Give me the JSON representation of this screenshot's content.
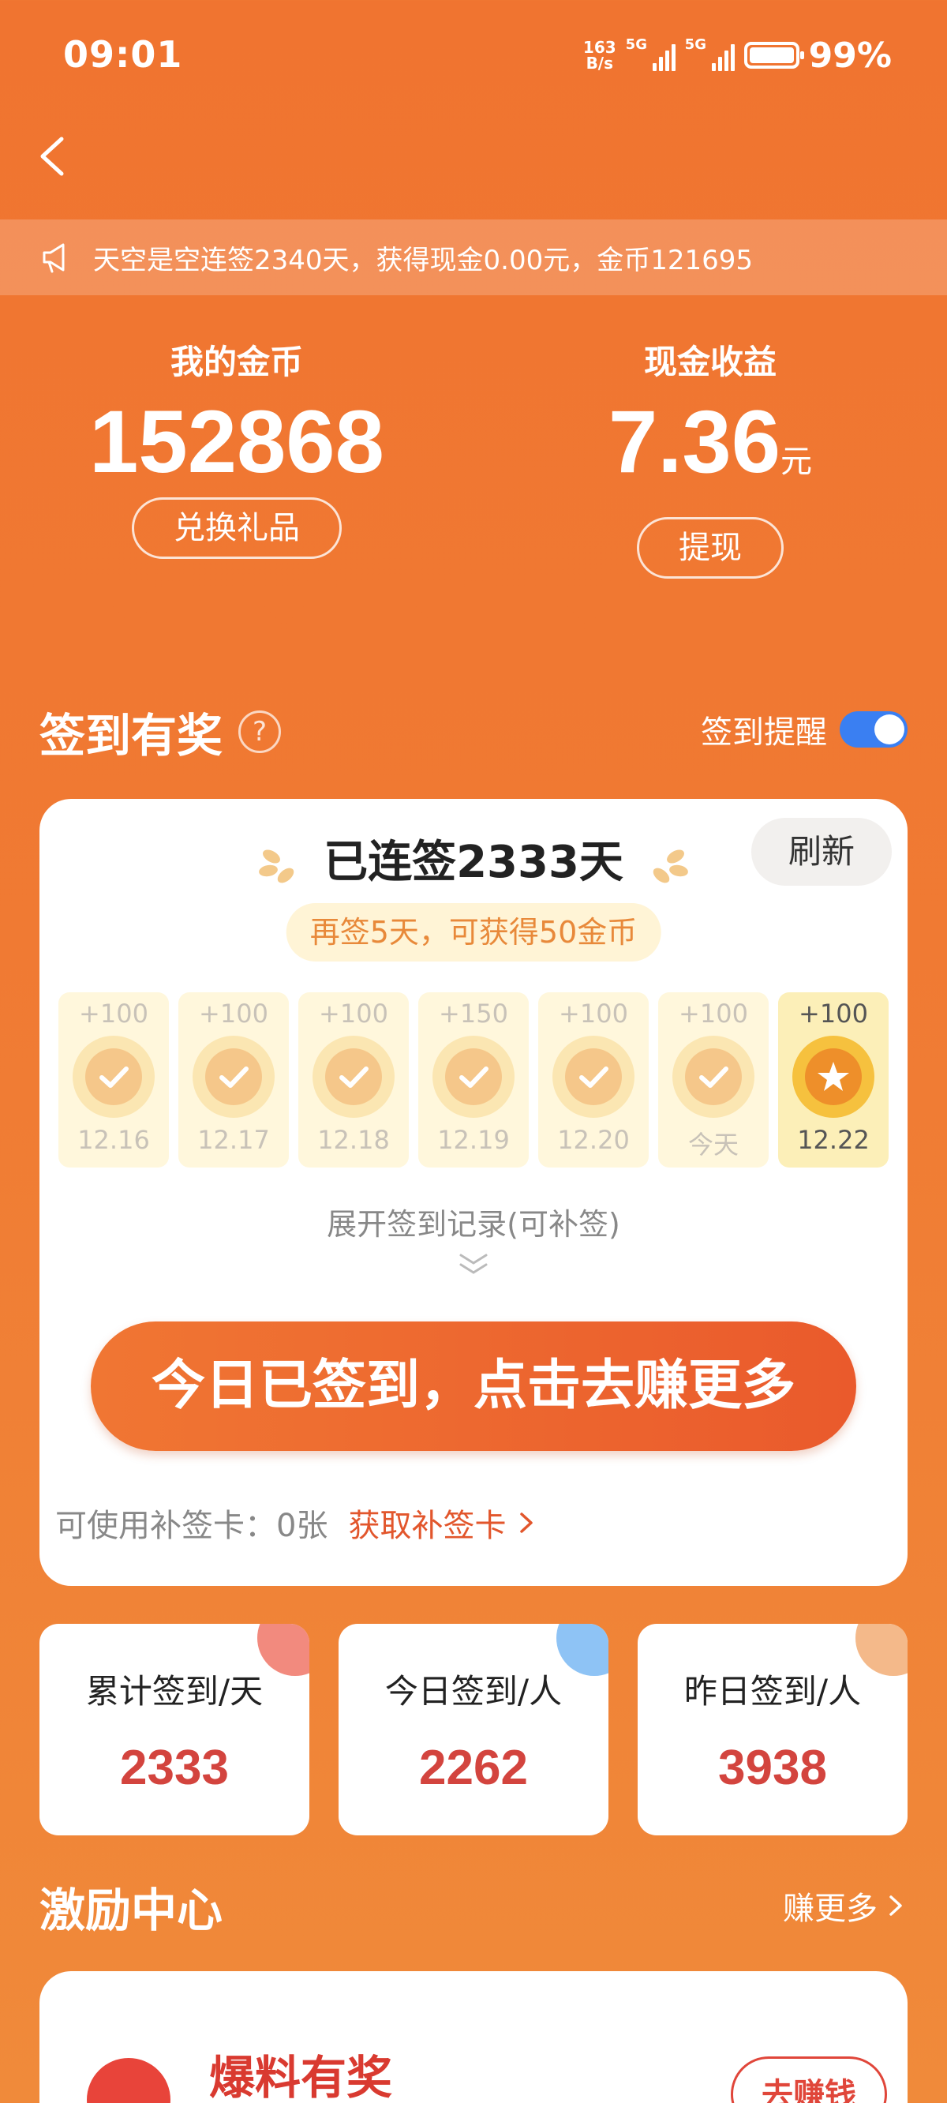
{
  "status_bar": {
    "time": "09:01",
    "net_speed_value": "163",
    "net_speed_unit": "B/s",
    "sim1": "5G",
    "sim2": "5G",
    "battery": "99%"
  },
  "notice": {
    "text": "天空是空连签2340天，获得现金0.00元，金币121695"
  },
  "summary": {
    "coins_label": "我的金币",
    "coins_value": "152868",
    "exchange_button": "兑换礼品",
    "cash_label": "现金收益",
    "cash_value": "7.36",
    "cash_unit": "元",
    "withdraw_button": "提现"
  },
  "sign_section": {
    "title": "签到有奖",
    "help_glyph": "?",
    "reminder_label": "签到提醒",
    "reminder_on": true
  },
  "sign_card": {
    "streak_text": "已连签2333天",
    "refresh_button": "刷新",
    "hint": "再签5天，可获得50金币",
    "days": [
      {
        "points": "+100",
        "date": "12.16",
        "signed": true
      },
      {
        "points": "+100",
        "date": "12.17",
        "signed": true
      },
      {
        "points": "+100",
        "date": "12.18",
        "signed": true
      },
      {
        "points": "+150",
        "date": "12.19",
        "signed": true
      },
      {
        "points": "+100",
        "date": "12.20",
        "signed": true
      },
      {
        "points": "+100",
        "date": "今天",
        "signed": true
      },
      {
        "points": "+100",
        "date": "12.22",
        "signed": false
      }
    ],
    "expand_text": "展开签到记录(可补签)",
    "main_button": "今日已签到，点击去赚更多",
    "makeup_label": "可使用补签卡：0张",
    "makeup_link": "获取补签卡"
  },
  "stats": [
    {
      "label": "累计签到/天",
      "value": "2333",
      "corner_color": "#F28A7E"
    },
    {
      "label": "今日签到/人",
      "value": "2262",
      "corner_color": "#8EC3F5"
    },
    {
      "label": "昨日签到/人",
      "value": "3938",
      "corner_color": "#F4B98A"
    }
  ],
  "incentive": {
    "title": "激励中心",
    "more_link": "赚更多",
    "item_name": "爆料有奖",
    "item_button": "去赚钱"
  }
}
